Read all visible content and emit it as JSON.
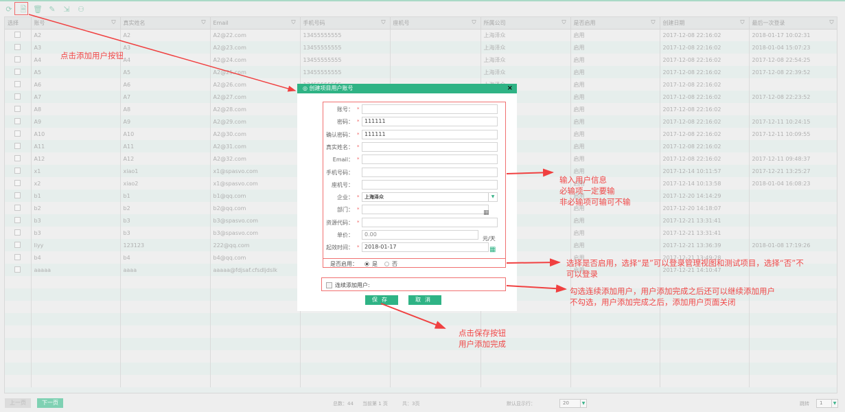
{
  "toolbar": {
    "icons": [
      "refresh-icon",
      "add-user-icon",
      "delete-icon",
      "edit-icon",
      "import-icon",
      "assign-user-icon"
    ],
    "glyphs": [
      "⟳",
      "🗎",
      "🗑",
      "✎",
      "⇲",
      "⚇"
    ]
  },
  "columns": [
    "选择",
    "账号",
    "真实姓名",
    "Email",
    "手机号码",
    "座机号",
    "所属公司",
    "是否启用",
    "创建日期",
    "最后一次登录"
  ],
  "rows": [
    [
      "A2",
      "A2",
      "A2@22.com",
      "13455555555",
      "",
      "上海泽众",
      "启用",
      "2017-12-08 22:16:02",
      "2018-01-17 10:02:31"
    ],
    [
      "A3",
      "A3",
      "A2@23.com",
      "13455555555",
      "",
      "上海泽众",
      "启用",
      "2017-12-08 22:16:02",
      "2018-01-04 15:07:23"
    ],
    [
      "A4",
      "A4",
      "A2@24.com",
      "13455555555",
      "",
      "上海泽众",
      "启用",
      "2017-12-08 22:16:02",
      "2017-12-08 22:54:25"
    ],
    [
      "A5",
      "A5",
      "A2@25.com",
      "13455555555",
      "",
      "上海泽众",
      "启用",
      "2017-12-08 22:16:02",
      "2017-12-08 22:39:52"
    ],
    [
      "A6",
      "A6",
      "A2@26.com",
      "13455555555",
      "",
      "上海泽众",
      "启用",
      "2017-12-08 22:16:02",
      ""
    ],
    [
      "A7",
      "A7",
      "A2@27.com",
      "",
      "",
      "",
      "启用",
      "2017-12-08 22:16:02",
      "2017-12-08 22:23:52"
    ],
    [
      "A8",
      "A8",
      "A2@28.com",
      "",
      "",
      "",
      "启用",
      "2017-12-08 22:16:02",
      ""
    ],
    [
      "A9",
      "A9",
      "A2@29.com",
      "",
      "",
      "",
      "启用",
      "2017-12-08 22:16:02",
      "2017-12-11 10:24:15"
    ],
    [
      "A10",
      "A10",
      "A2@30.com",
      "",
      "",
      "",
      "启用",
      "2017-12-08 22:16:02",
      "2017-12-11 10:09:55"
    ],
    [
      "A11",
      "A11",
      "A2@31.com",
      "",
      "",
      "",
      "启用",
      "2017-12-08 22:16:02",
      ""
    ],
    [
      "A12",
      "A12",
      "A2@32.com",
      "",
      "",
      "",
      "启用",
      "2017-12-08 22:16:02",
      "2017-12-11 09:48:37"
    ],
    [
      "x1",
      "xiao1",
      "x1@spasvo.com",
      "",
      "",
      "",
      "启用",
      "2017-12-14 10:11:57",
      "2017-12-21 13:25:27"
    ],
    [
      "x2",
      "xiao2",
      "x1@spasvo.com",
      "",
      "",
      "",
      "启用",
      "2017-12-14 10:13:58",
      "2018-01-04 16:08:23"
    ],
    [
      "b1",
      "b1",
      "b1@qq.com",
      "",
      "",
      "",
      "启用",
      "2017-12-20 14:14:29",
      ""
    ],
    [
      "b2",
      "b2",
      "b2@qq.com",
      "",
      "",
      "",
      "启用",
      "2017-12-20 14:18:07",
      ""
    ],
    [
      "b3",
      "b3",
      "b3@spasvo.com",
      "",
      "",
      "",
      "启用",
      "2017-12-21 13:31:41",
      ""
    ],
    [
      "b3",
      "b3",
      "b3@spasvo.com",
      "",
      "",
      "",
      "启用",
      "2017-12-21 13:31:41",
      ""
    ],
    [
      "liyy",
      "123123",
      "222@qq.com",
      "",
      "",
      "",
      "启用",
      "2017-12-21 13:36:39",
      "2018-01-08 17:19:26"
    ],
    [
      "b4",
      "b4",
      "b4@qq.com",
      "",
      "",
      "",
      "启用",
      "2017-12-21 13:49:28",
      ""
    ],
    [
      "aaaaa",
      "aaaa",
      "aaaaa@fdjsaf.cfsdljdslk",
      "",
      "",
      "",
      "启用",
      "2017-12-21 14:10:47",
      ""
    ]
  ],
  "footer": {
    "prev": "上一页",
    "next": "下一页",
    "total": "总数：44",
    "current": "当前第 1 页",
    "pages": "共：3页",
    "page_size_label": "默认显示行：",
    "page_size": "20",
    "jump_label": "跳转",
    "jump_page": "1"
  },
  "dialog": {
    "title": "创建项目用户账号",
    "close": "×",
    "fields": [
      {
        "label": "账号：",
        "required": true,
        "value": ""
      },
      {
        "label": "密码：",
        "required": true,
        "value": "111111"
      },
      {
        "label": "确认密码：",
        "required": true,
        "value": "111111"
      },
      {
        "label": "真实姓名：",
        "required": true,
        "value": ""
      },
      {
        "label": "Email：",
        "required": true,
        "value": ""
      },
      {
        "label": "手机号码：",
        "required": false,
        "value": ""
      },
      {
        "label": "座机号：",
        "required": false,
        "value": ""
      },
      {
        "label": "企业：",
        "required": true,
        "value": "上海泽众"
      },
      {
        "label": "部门：",
        "required": true,
        "value": ""
      },
      {
        "label": "资源代码：",
        "required": true,
        "value": ""
      },
      {
        "label": "单价：",
        "required": false,
        "value": "0.00"
      },
      {
        "label": "起效时间：",
        "required": true,
        "value": "2018-01-17"
      }
    ],
    "unit": "元/天",
    "star": "*",
    "enable_label": "是否启用：",
    "yes": "是",
    "no": "否",
    "continuous": "连续添加用户:",
    "save": "保存",
    "cancel": "取消"
  },
  "annotations": {
    "add_button": "点击添加用户按钮",
    "info": [
      "输入用户信息",
      "必输项一定要输",
      "非必输项可输可不输"
    ],
    "enable": [
      "选择是否启用，选择“是”可以登录管理视图和测试项目，选择“否”不",
      "可以登录"
    ],
    "continuous": [
      "勾选连续添加用户，用户添加完成之后还可以继续添加用户",
      "不勾选，用户添加完成之后，添加用户页面关闭"
    ],
    "save": [
      "点击保存按钮",
      "用户添加完成"
    ]
  },
  "colors": {
    "accent": "#2fb385",
    "annotation": "#f04848"
  }
}
